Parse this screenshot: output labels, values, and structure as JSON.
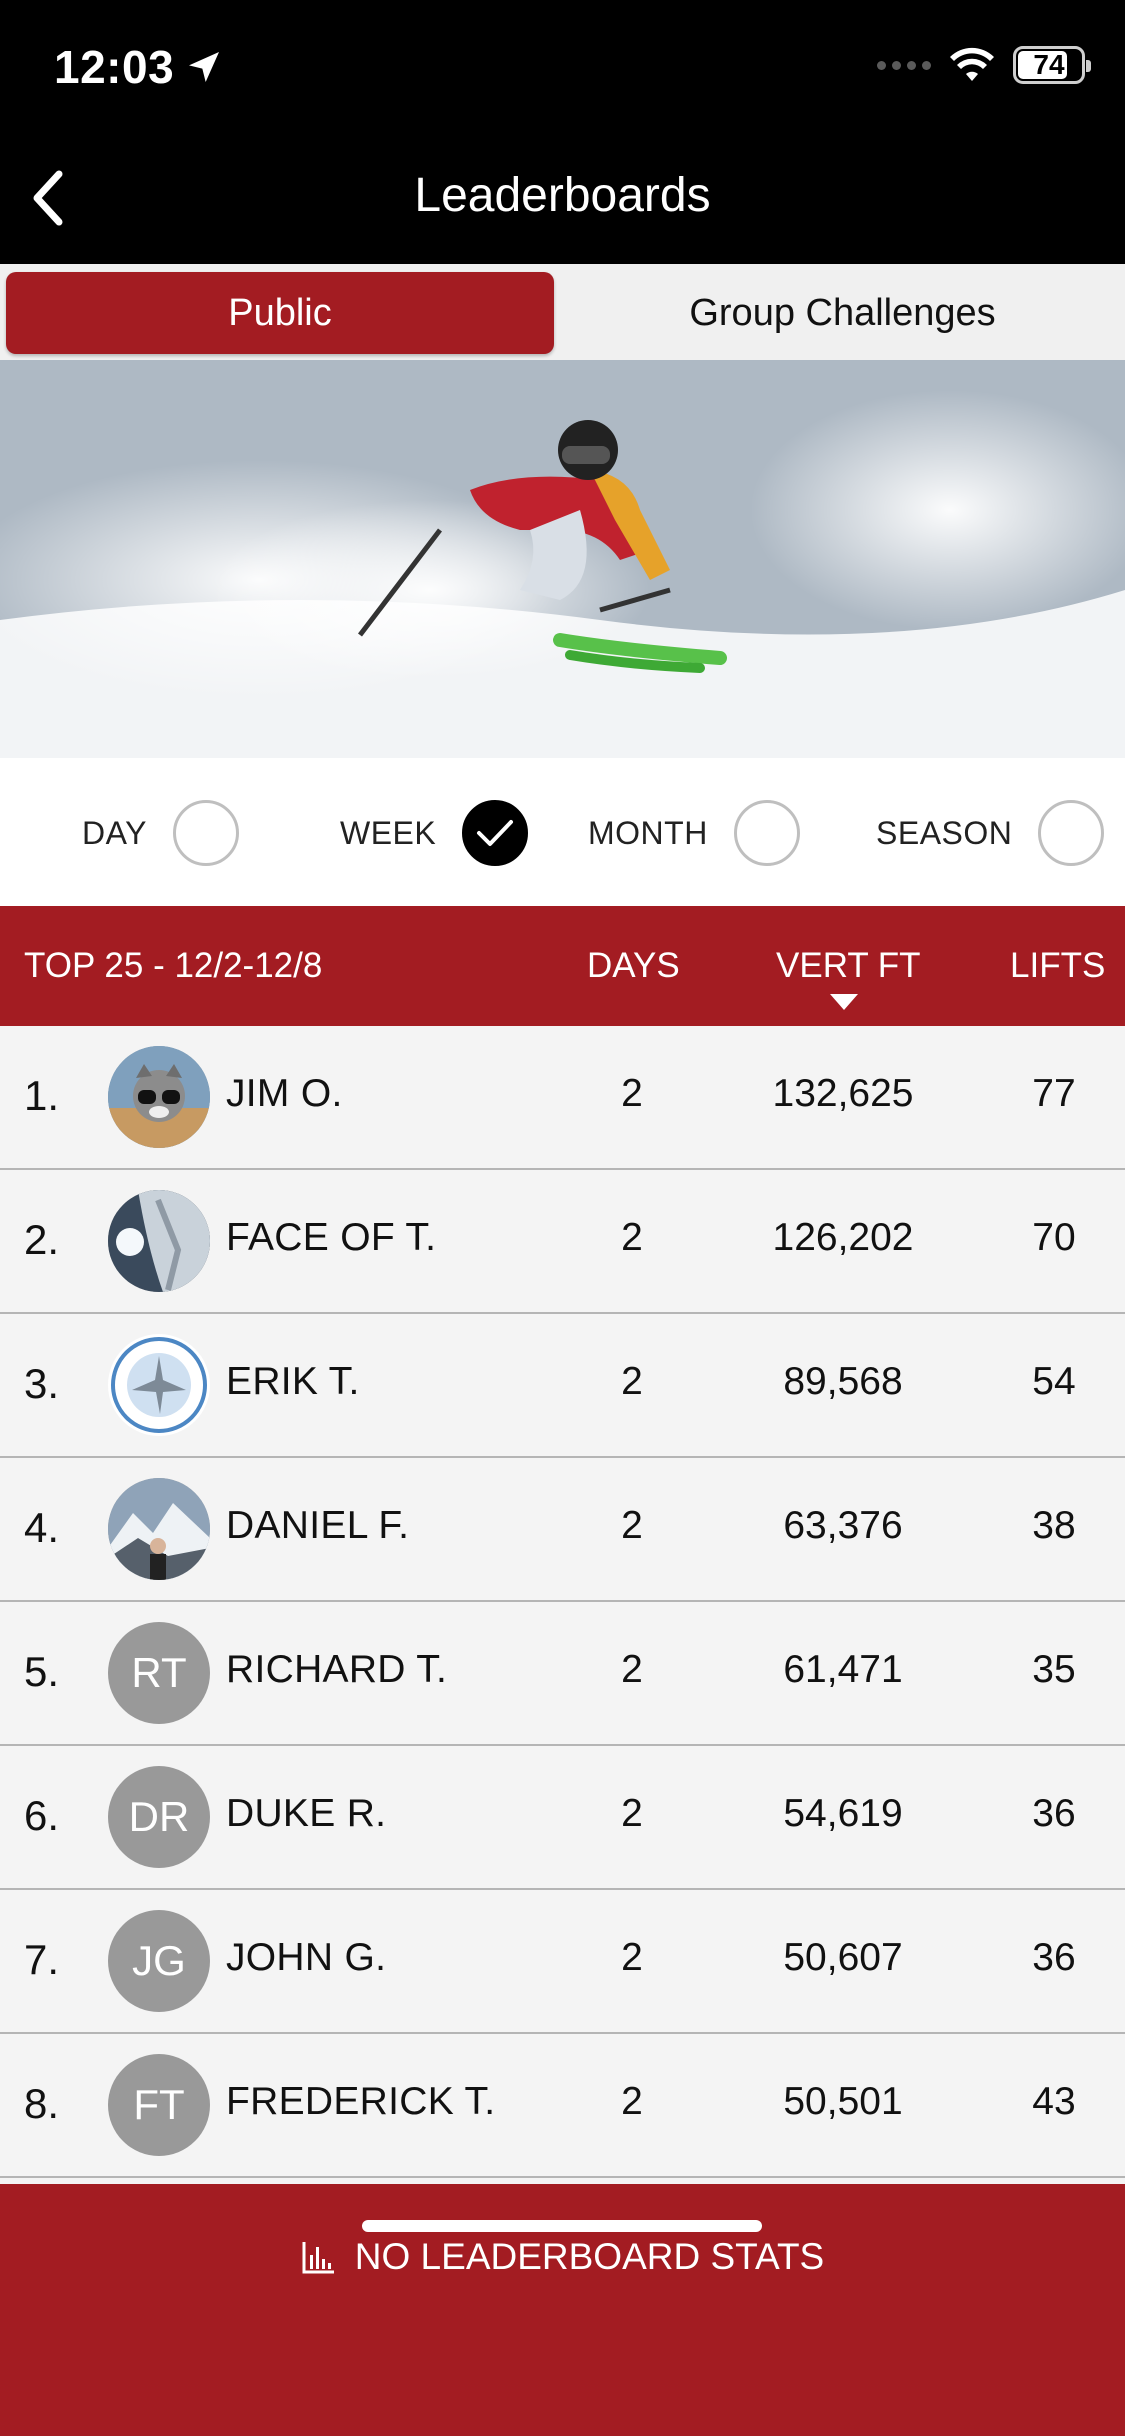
{
  "status_bar": {
    "time": "12:03",
    "battery": "74"
  },
  "nav": {
    "title": "Leaderboards"
  },
  "tabs": [
    {
      "label": "Public",
      "active": true
    },
    {
      "label": "Group Challenges",
      "active": false
    }
  ],
  "periods": [
    {
      "label": "DAY",
      "checked": false
    },
    {
      "label": "WEEK",
      "checked": true
    },
    {
      "label": "MONTH",
      "checked": false
    },
    {
      "label": "SEASON",
      "checked": false
    }
  ],
  "table": {
    "title": "TOP 25 - 12/2-12/8",
    "columns": [
      "DAYS",
      "VERT FT",
      "LIFTS"
    ],
    "sorted_by": "VERT FT",
    "rows": [
      {
        "rank": "1.",
        "name": "JIM O.",
        "avatar": "photo",
        "initials": "",
        "days": "2",
        "vert": "132,625",
        "lifts": "77"
      },
      {
        "rank": "2.",
        "name": "FACE OF T.",
        "avatar": "photo",
        "initials": "",
        "days": "2",
        "vert": "126,202",
        "lifts": "70"
      },
      {
        "rank": "3.",
        "name": "ERIK T.",
        "avatar": "photo",
        "initials": "",
        "days": "2",
        "vert": "89,568",
        "lifts": "54"
      },
      {
        "rank": "4.",
        "name": "DANIEL F.",
        "avatar": "photo",
        "initials": "",
        "days": "2",
        "vert": "63,376",
        "lifts": "38"
      },
      {
        "rank": "5.",
        "name": "RICHARD T.",
        "avatar": "initials",
        "initials": "RT",
        "days": "2",
        "vert": "61,471",
        "lifts": "35"
      },
      {
        "rank": "6.",
        "name": "DUKE R.",
        "avatar": "initials",
        "initials": "DR",
        "days": "2",
        "vert": "54,619",
        "lifts": "36"
      },
      {
        "rank": "7.",
        "name": "JOHN G.",
        "avatar": "initials",
        "initials": "JG",
        "days": "2",
        "vert": "50,607",
        "lifts": "36"
      },
      {
        "rank": "8.",
        "name": "FREDERICK T.",
        "avatar": "initials",
        "initials": "FT",
        "days": "2",
        "vert": "50,501",
        "lifts": "43"
      }
    ]
  },
  "footer": {
    "cta": "NO LEADERBOARD STATS",
    "icon": "bar-chart-icon"
  },
  "colors": {
    "brand": "#a31c22",
    "header_bg": "#000000",
    "row_bg": "#f4f4f4"
  }
}
